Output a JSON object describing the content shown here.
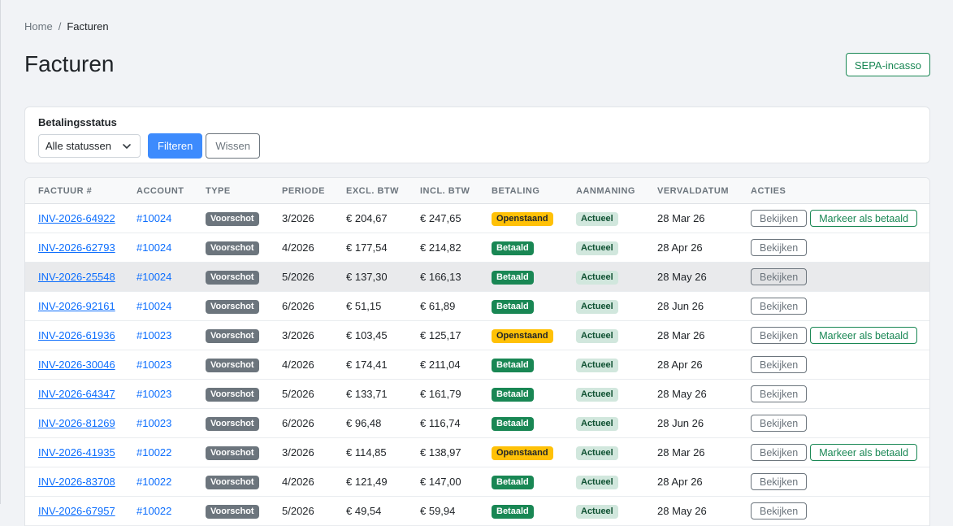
{
  "breadcrumb": {
    "home": "Home",
    "sep": "/",
    "current": "Facturen"
  },
  "page": {
    "title": "Facturen",
    "sepa_button": "SEPA-incasso"
  },
  "filter": {
    "label": "Betalingsstatus",
    "select_value": "Alle statussen",
    "filter_button": "Filteren",
    "clear_button": "Wissen"
  },
  "table": {
    "headers": [
      "Factuur #",
      "Account",
      "Type",
      "Periode",
      "Excl. BTW",
      "Incl. BTW",
      "Betaling",
      "Aanmaning",
      "Vervaldatum",
      "Acties"
    ],
    "view_label": "Bekijken",
    "mark_label": "Markeer als betaald",
    "rows": [
      {
        "invoice": "INV-2026-64922",
        "account": "#10024",
        "type": "Voorschot",
        "period": "3/2026",
        "excl": "€ 204,67",
        "incl": "€ 247,65",
        "payment": "Openstaand",
        "reminder": "Actueel",
        "due": "28 Mar 26",
        "can_mark": true,
        "hover": false
      },
      {
        "invoice": "INV-2026-62793",
        "account": "#10024",
        "type": "Voorschot",
        "period": "4/2026",
        "excl": "€ 177,54",
        "incl": "€ 214,82",
        "payment": "Betaald",
        "reminder": "Actueel",
        "due": "28 Apr 26",
        "can_mark": false,
        "hover": false
      },
      {
        "invoice": "INV-2026-25548",
        "account": "#10024",
        "type": "Voorschot",
        "period": "5/2026",
        "excl": "€ 137,30",
        "incl": "€ 166,13",
        "payment": "Betaald",
        "reminder": "Actueel",
        "due": "28 May 26",
        "can_mark": false,
        "hover": true
      },
      {
        "invoice": "INV-2026-92161",
        "account": "#10024",
        "type": "Voorschot",
        "period": "6/2026",
        "excl": "€ 51,15",
        "incl": "€ 61,89",
        "payment": "Betaald",
        "reminder": "Actueel",
        "due": "28 Jun 26",
        "can_mark": false,
        "hover": false
      },
      {
        "invoice": "INV-2026-61936",
        "account": "#10023",
        "type": "Voorschot",
        "period": "3/2026",
        "excl": "€ 103,45",
        "incl": "€ 125,17",
        "payment": "Openstaand",
        "reminder": "Actueel",
        "due": "28 Mar 26",
        "can_mark": true,
        "hover": false
      },
      {
        "invoice": "INV-2026-30046",
        "account": "#10023",
        "type": "Voorschot",
        "period": "4/2026",
        "excl": "€ 174,41",
        "incl": "€ 211,04",
        "payment": "Betaald",
        "reminder": "Actueel",
        "due": "28 Apr 26",
        "can_mark": false,
        "hover": false
      },
      {
        "invoice": "INV-2026-64347",
        "account": "#10023",
        "type": "Voorschot",
        "period": "5/2026",
        "excl": "€ 133,71",
        "incl": "€ 161,79",
        "payment": "Betaald",
        "reminder": "Actueel",
        "due": "28 May 26",
        "can_mark": false,
        "hover": false
      },
      {
        "invoice": "INV-2026-81269",
        "account": "#10023",
        "type": "Voorschot",
        "period": "6/2026",
        "excl": "€ 96,48",
        "incl": "€ 116,74",
        "payment": "Betaald",
        "reminder": "Actueel",
        "due": "28 Jun 26",
        "can_mark": false,
        "hover": false
      },
      {
        "invoice": "INV-2026-41935",
        "account": "#10022",
        "type": "Voorschot",
        "period": "3/2026",
        "excl": "€ 114,85",
        "incl": "€ 138,97",
        "payment": "Openstaand",
        "reminder": "Actueel",
        "due": "28 Mar 26",
        "can_mark": true,
        "hover": false
      },
      {
        "invoice": "INV-2026-83708",
        "account": "#10022",
        "type": "Voorschot",
        "period": "4/2026",
        "excl": "€ 121,49",
        "incl": "€ 147,00",
        "payment": "Betaald",
        "reminder": "Actueel",
        "due": "28 Apr 26",
        "can_mark": false,
        "hover": false
      },
      {
        "invoice": "INV-2026-67957",
        "account": "#10022",
        "type": "Voorschot",
        "period": "5/2026",
        "excl": "€ 49,54",
        "incl": "€ 59,94",
        "payment": "Betaald",
        "reminder": "Actueel",
        "due": "28 May 26",
        "can_mark": false,
        "hover": false
      }
    ]
  },
  "colors": {
    "primary": "#3d8bfd",
    "success": "#198754",
    "warning": "#ffc107",
    "secondary": "#6c757d"
  }
}
